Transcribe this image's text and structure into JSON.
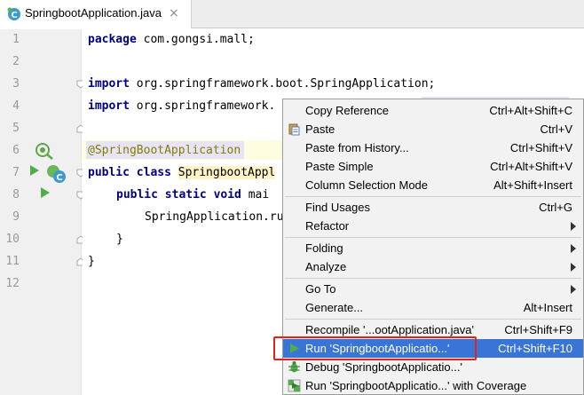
{
  "tab": {
    "title": "SpringbootApplication.java",
    "close": "×"
  },
  "gutter": {
    "line_numbers": [
      "1",
      "2",
      "3",
      "4",
      "5",
      "6",
      "7",
      "8",
      "9",
      "10",
      "11",
      "12"
    ]
  },
  "code": {
    "line1": {
      "kw": "package",
      "rest": " com.gongsi.mall;"
    },
    "line3": {
      "kw": "import",
      "rest": " org.springframework.boot.SpringApplication;"
    },
    "line4": {
      "kw": "import",
      "rest": " org.springframework."
    },
    "line6": {
      "ann": "@SpringBootApplication"
    },
    "line7": {
      "kw": "public class",
      "cls": "SpringbootAppl"
    },
    "line8": {
      "kw": "public static void",
      "rest": " mai"
    },
    "line9": {
      "rest": "SpringApplication.ru"
    },
    "line10": {
      "rest": "}"
    },
    "line11": {
      "rest": "}"
    }
  },
  "menu": {
    "copy_reference": {
      "label": "Copy Reference",
      "shortcut": "Ctrl+Alt+Shift+C"
    },
    "paste": {
      "label": "Paste",
      "shortcut": "Ctrl+V"
    },
    "paste_history": {
      "label": "Paste from History...",
      "shortcut": "Ctrl+Shift+V"
    },
    "paste_simple": {
      "label": "Paste Simple",
      "shortcut": "Ctrl+Alt+Shift+V"
    },
    "column_selection": {
      "label": "Column Selection Mode",
      "shortcut": "Alt+Shift+Insert"
    },
    "find_usages": {
      "label": "Find Usages",
      "shortcut": "Ctrl+G"
    },
    "refactor": {
      "label": "Refactor"
    },
    "folding": {
      "label": "Folding"
    },
    "analyze": {
      "label": "Analyze"
    },
    "go_to": {
      "label": "Go To"
    },
    "generate": {
      "label": "Generate...",
      "shortcut": "Alt+Insert"
    },
    "recompile": {
      "label": "Recompile '...ootApplication.java'",
      "shortcut": "Ctrl+Shift+F9"
    },
    "run": {
      "label": "Run 'SpringbootApplicatio...'",
      "shortcut": "Ctrl+Shift+F10"
    },
    "debug": {
      "label": "Debug 'SpringbootApplicatio...'"
    },
    "run_coverage": {
      "label": "Run 'SpringbootApplicatio...' with Coverage"
    }
  },
  "colors": {
    "selection": "#3875d7",
    "highlight_border": "#e2231a",
    "run_green": "#4fae4a"
  },
  "icons": [
    "java-class-icon",
    "spring-bean-icon",
    "run-gutter-icon",
    "paste-icon",
    "run-icon",
    "debug-icon",
    "coverage-icon"
  ]
}
